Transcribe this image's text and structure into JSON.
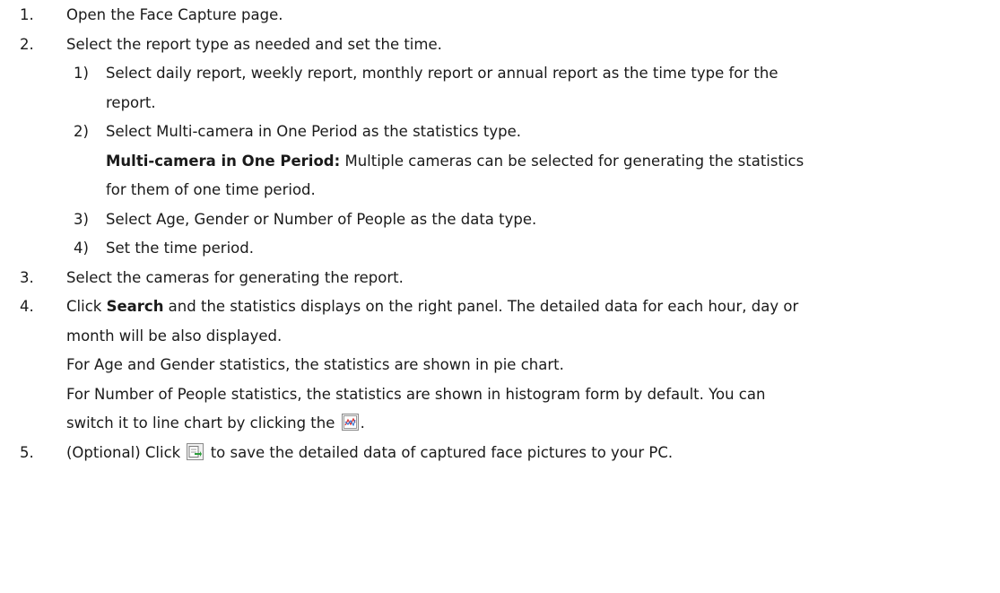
{
  "steps": [
    {
      "num": "1.",
      "text": "Open the Face Capture page."
    },
    {
      "num": "2.",
      "text": "Select the report type as needed and set the time."
    },
    {
      "num": "3.",
      "text": "Select the cameras for generating the report."
    },
    {
      "num": "4.",
      "bold": "Search",
      "pre": "Click ",
      "text_line1": " and the statistics displays on the right panel. The detailed data for each hour, day or",
      "text_line2": "month will be also displayed.",
      "para_age": "For Age and Gender statistics, the statistics are shown in pie chart.",
      "para_people_line1": "For Number of People statistics, the statistics are shown in histogram form by default. You can",
      "para_people_line2": "switch it to line chart by clicking the",
      "para_people_end": "."
    },
    {
      "num": "5.",
      "pre": "(Optional) Click",
      "post": " to save the detailed data of captured face pictures to your PC."
    }
  ],
  "substeps": [
    {
      "num": "1)",
      "line1": "Select daily report, weekly report, monthly report or annual report as the time type for the",
      "line2": "report."
    },
    {
      "num": "2)",
      "line1": "Select Multi-camera in One Period as the statistics type.",
      "bold": "Multi-camera in One Period:",
      "desc_line1": " Multiple cameras can be selected for generating the statistics",
      "desc_line2": "for them of one time period."
    },
    {
      "num": "3)",
      "line1": "Select Age, Gender or Number of People as the data type."
    },
    {
      "num": "4)",
      "line1": "Set the time period."
    }
  ],
  "icons": {
    "line_chart": "line-chart-icon",
    "export": "export-icon"
  }
}
